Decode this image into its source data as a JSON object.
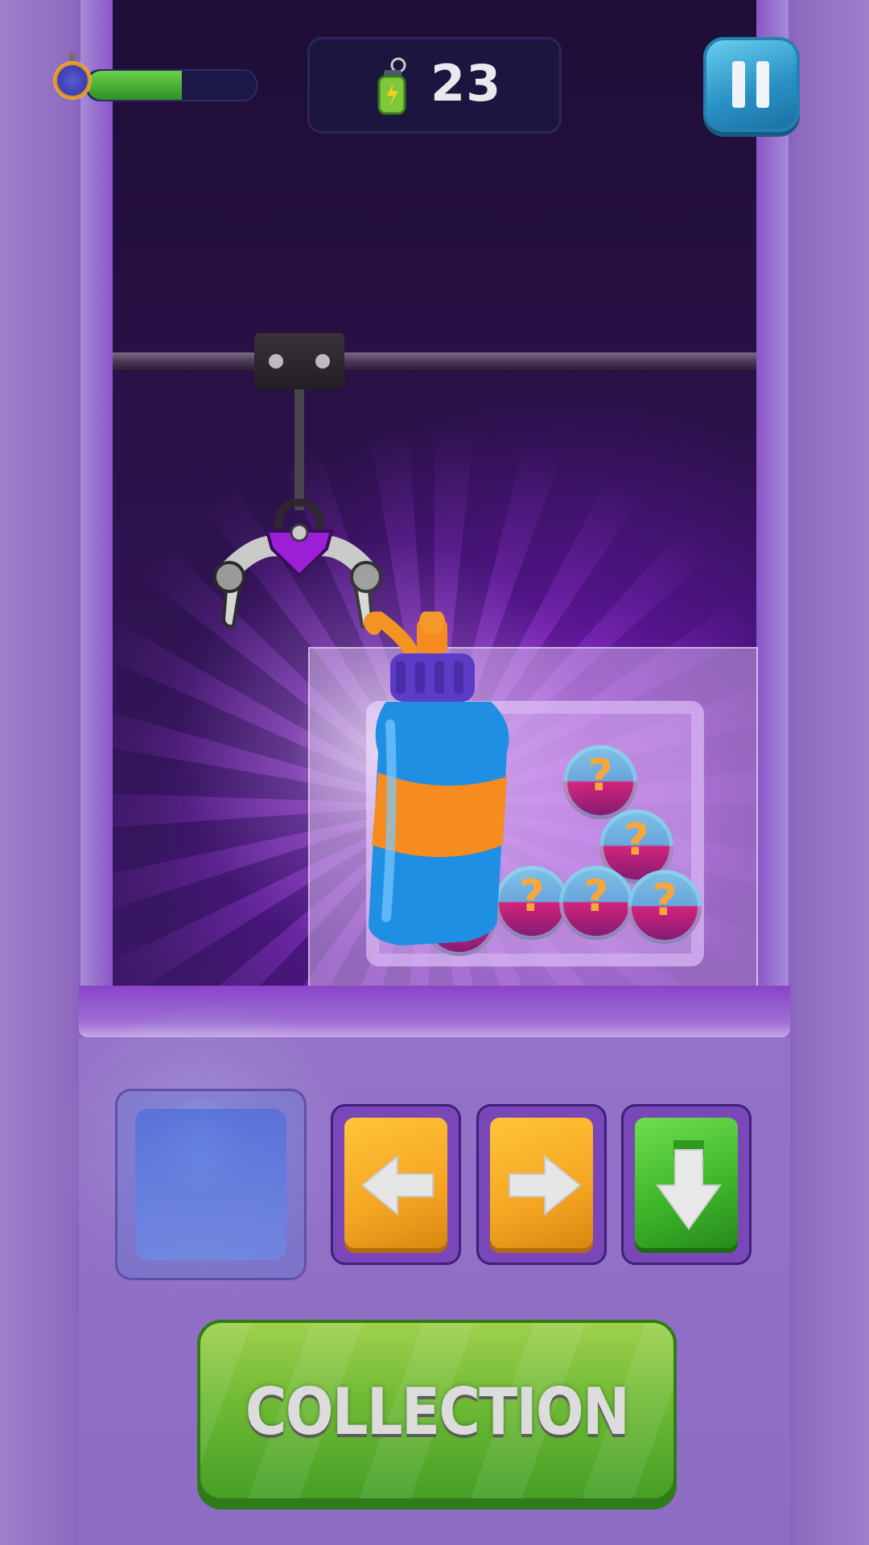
{
  "hud": {
    "timer_progress": 0.56,
    "score_value": "23",
    "score_icon": "battery-keychain-icon",
    "pause_icon": "pause-icon"
  },
  "controls": {
    "left_icon": "arrow-left-icon",
    "right_icon": "arrow-right-icon",
    "down_icon": "arrow-down-icon"
  },
  "collection_button": {
    "label": "COLLECTION"
  },
  "colors": {
    "accent_purple": "#8c67b7",
    "button_green": "#6fba35",
    "button_orange": "#f5a623",
    "pause_blue": "#2a92c6"
  }
}
